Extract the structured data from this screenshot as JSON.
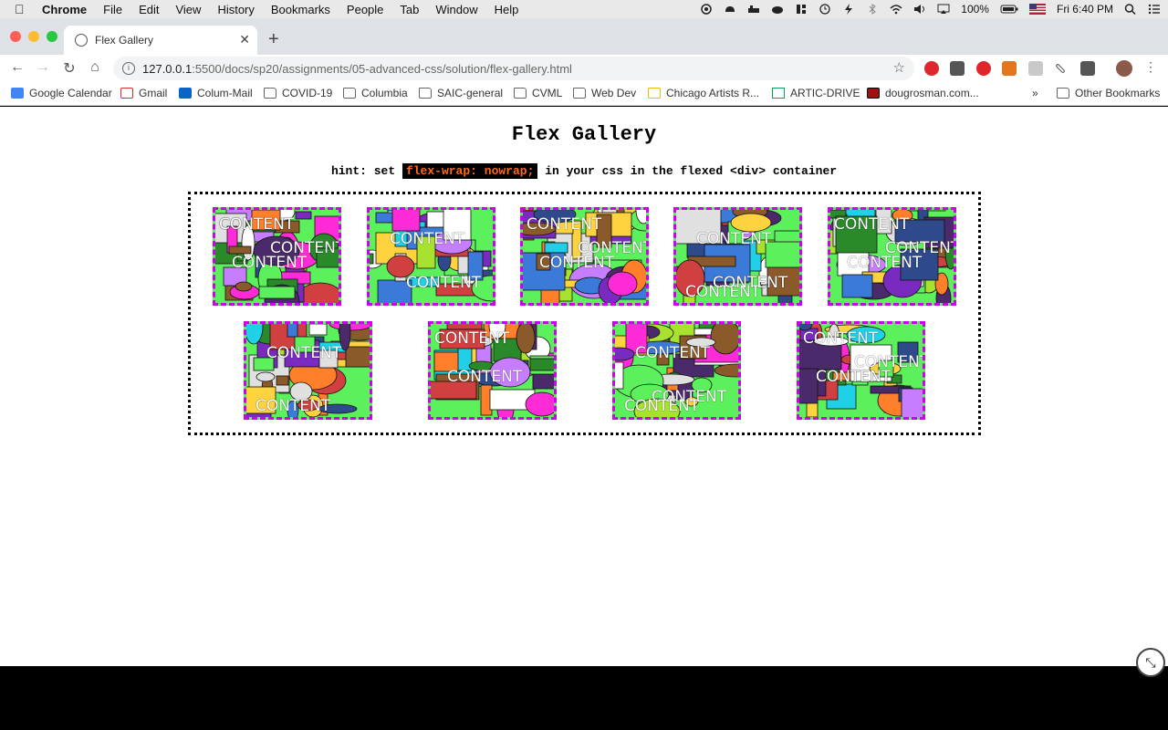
{
  "menubar": {
    "app": "Chrome",
    "items": [
      "File",
      "Edit",
      "View",
      "History",
      "Bookmarks",
      "People",
      "Tab",
      "Window",
      "Help"
    ],
    "battery": "100%",
    "clock": "Fri 6:40 PM"
  },
  "tab": {
    "title": "Flex Gallery"
  },
  "address": {
    "host": "127.0.0.1",
    "path": ":5500/docs/sp20/assignments/05-advanced-css/solution/flex-gallery.html"
  },
  "bookmarks": [
    {
      "label": "Google Calendar",
      "icon": "calendar-icon"
    },
    {
      "label": "Gmail",
      "icon": "gmail-icon"
    },
    {
      "label": "Colum-Mail",
      "icon": "outlook-icon"
    },
    {
      "label": "COVID-19",
      "icon": "folder-icon"
    },
    {
      "label": "Columbia",
      "icon": "folder-icon"
    },
    {
      "label": "SAIC-general",
      "icon": "folder-icon"
    },
    {
      "label": "CVML",
      "icon": "folder-icon"
    },
    {
      "label": "Web Dev",
      "icon": "folder-icon"
    },
    {
      "label": "Chicago Artists R...",
      "icon": "slides-icon"
    },
    {
      "label": "ARTIC-DRIVE",
      "icon": "drive-icon"
    },
    {
      "label": "dougrosman.com...",
      "icon": "site-icon"
    }
  ],
  "bookmarks_overflow": "»",
  "other_bookmarks": "Other Bookmarks",
  "page": {
    "title": "Flex Gallery",
    "hint_prefix": "hint: set ",
    "hint_code": "flex-wrap: nowrap;",
    "hint_suffix": " in your css in the flexed <div> container"
  },
  "gallery": {
    "border_color": "#cc00ee",
    "cards": [
      {
        "label": "CONTENT"
      },
      {
        "label": "CONTENT"
      },
      {
        "label": "CONTENT"
      },
      {
        "label": "CONTENT"
      },
      {
        "label": "CONTENT"
      },
      {
        "label": "CONTENT"
      },
      {
        "label": "CONTENT"
      },
      {
        "label": "CONTENT"
      },
      {
        "label": "CONTENT"
      }
    ]
  },
  "colors": {
    "hint_code_bg": "#000000",
    "hint_code_fg": "#ff6a1a",
    "card_border": "#cc00ee"
  }
}
